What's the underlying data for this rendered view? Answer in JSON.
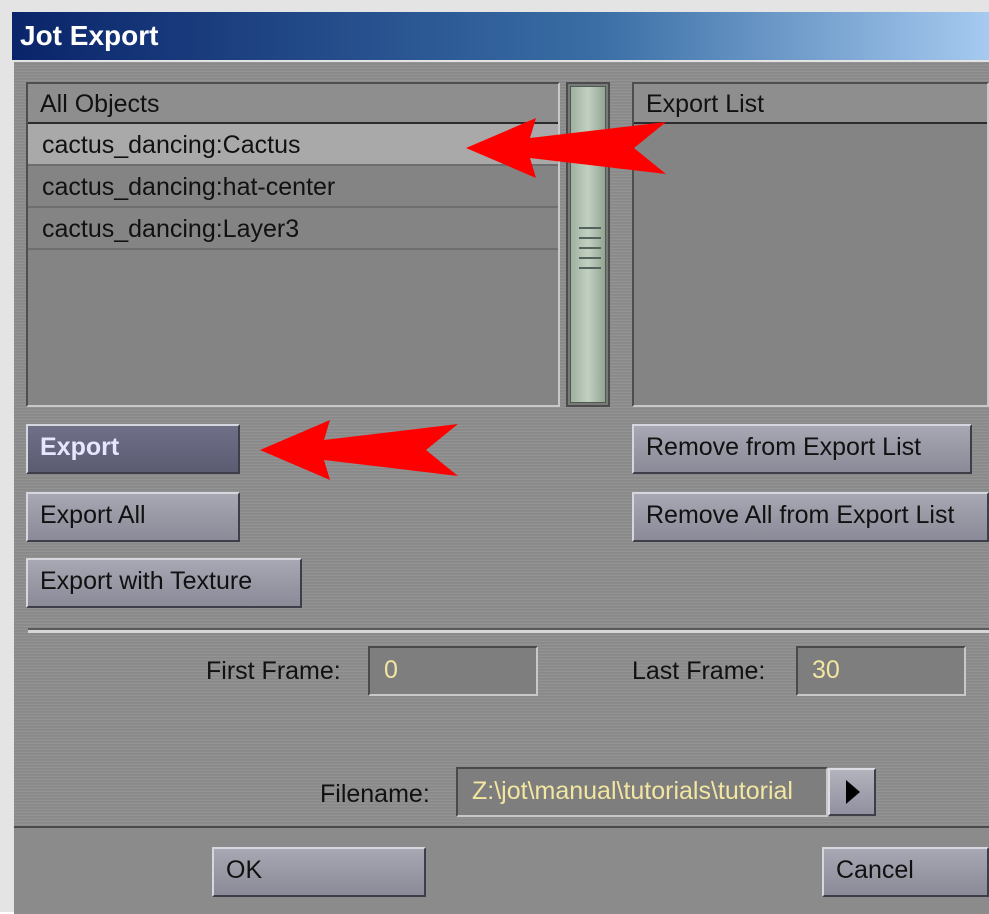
{
  "window": {
    "title": "Jot Export"
  },
  "all_objects": {
    "header": "All Objects",
    "items": [
      "cactus_dancing:Cactus",
      "cactus_dancing:hat-center",
      "cactus_dancing:Layer3"
    ]
  },
  "export_list": {
    "header": "Export List",
    "items": []
  },
  "buttons": {
    "export": "Export",
    "export_all": "Export All",
    "export_with_texture": "Export with Texture",
    "remove_from_export_list": "Remove from Export List",
    "remove_all_from_export_list": "Remove All from Export List",
    "ok": "OK",
    "cancel": "Cancel"
  },
  "frames": {
    "first_label": "First Frame:",
    "first_value": "0",
    "last_label": "Last Frame:",
    "last_value": "30"
  },
  "file": {
    "label": "Filename:",
    "value": "Z:\\jot\\manual\\tutorials\\tutorial"
  },
  "colors": {
    "annotation_arrow": "#ff0000",
    "field_text": "#f2e6a0"
  },
  "icons": [
    "play-arrow-icon"
  ]
}
